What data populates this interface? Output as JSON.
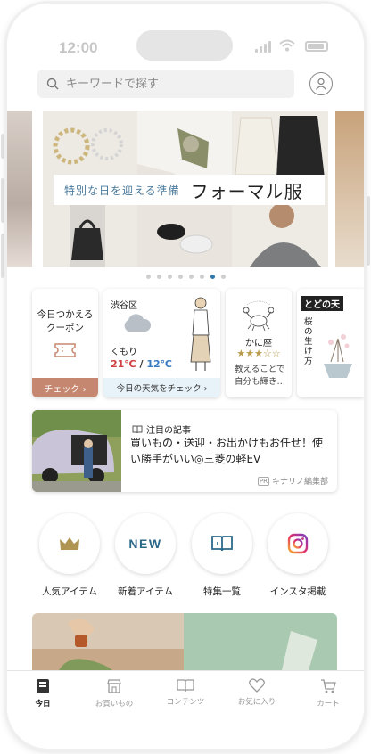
{
  "status": {
    "time": "12:00"
  },
  "search": {
    "placeholder": "キーワードで探す"
  },
  "banner": {
    "subtitle": "特別な日を迎える準備",
    "title": "フォーマル服",
    "dot_count": 7,
    "active_dot": 6
  },
  "cards": {
    "coupon": {
      "title": "今日つかえる\nクーポン",
      "button": "チェック ›"
    },
    "weather": {
      "region": "渋谷区",
      "desc": "くもり",
      "high": "21℃",
      "slash": "/",
      "low": "12℃",
      "button": "今日の天気をチェック ›"
    },
    "horoscope": {
      "sign": "かに座",
      "stars": "★★★☆☆",
      "text": "教えることで\n自分も輝き…"
    },
    "season": {
      "head": "とどの天",
      "text": "桜の生け方"
    }
  },
  "article": {
    "category": "注目の記事",
    "title": "買いもの・送迎・お出かけもお任せ！使い勝手がいい◎三菱の軽EV",
    "pr": "PR",
    "source": "キナリノ編集部"
  },
  "quick_links": [
    {
      "label": "人気アイテム",
      "icon": "crown-icon"
    },
    {
      "label": "新着アイテム",
      "icon": "new-icon",
      "badge": "NEW"
    },
    {
      "label": "特集一覧",
      "icon": "book-icon"
    },
    {
      "label": "インスタ掲載",
      "icon": "instagram-icon"
    }
  ],
  "tabs": [
    {
      "label": "今日",
      "icon": "today-icon",
      "active": true
    },
    {
      "label": "お買いもの",
      "icon": "shop-icon",
      "active": false
    },
    {
      "label": "コンテンツ",
      "icon": "book-icon",
      "active": false
    },
    {
      "label": "お気に入り",
      "icon": "heart-icon",
      "active": false
    },
    {
      "label": "カート",
      "icon": "cart-icon",
      "active": false
    }
  ],
  "colors": {
    "accent": "#2f78ac",
    "coupon": "#c5876f",
    "weather_bg": "#e7f2f9",
    "temp_high": "#d04040",
    "temp_low": "#3a7cc2"
  }
}
